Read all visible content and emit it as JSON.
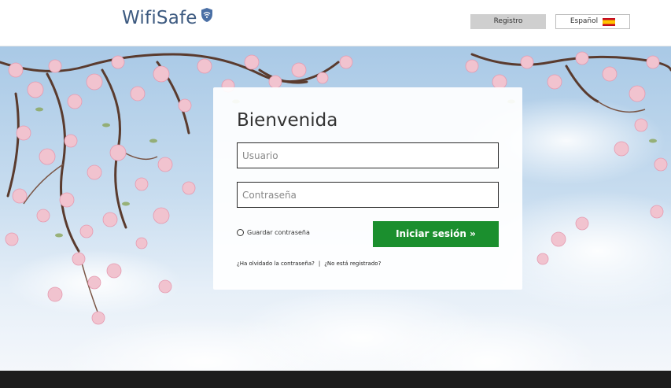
{
  "header": {
    "logo_text": "WifiSafe",
    "register_label": "Registro",
    "language": {
      "selected": "Español",
      "flag_icon": "spain-flag-icon"
    }
  },
  "login": {
    "title": "Bienvenida",
    "username_placeholder": "Usuario",
    "password_placeholder": "Contraseña",
    "remember_label": "Guardar contraseña",
    "submit_label": "Iniciar sesión »",
    "forgot_link": "¿Ha olvidado la contraseña?",
    "separator": "|",
    "not_registered_link": "¿No está registrado?"
  },
  "colors": {
    "brand": "#3d5a80",
    "primary_button": "#1b8f2e",
    "register_button": "#cfcfcf",
    "footer": "#1d1d1d"
  }
}
